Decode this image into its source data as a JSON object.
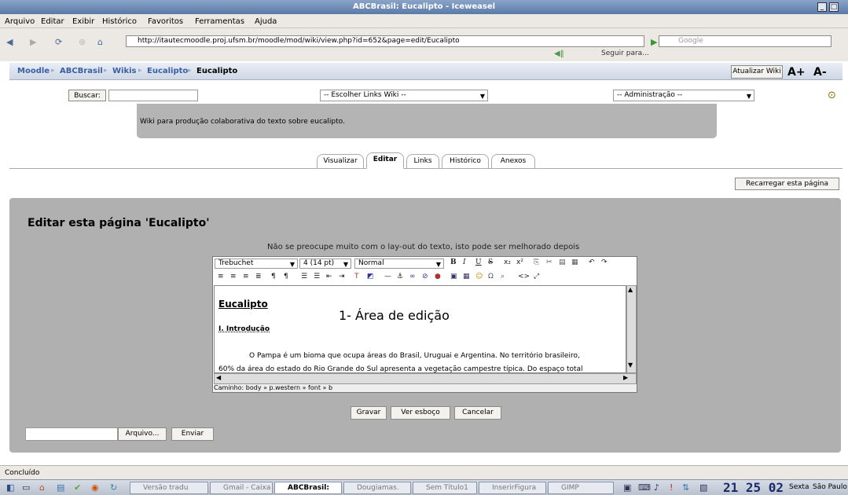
{
  "window": {
    "title": "ABCBrasil: Eucalipto - Iceweasel"
  },
  "menu": [
    "Arquivo",
    "Editar",
    "Exibir",
    "Histórico",
    "Favoritos",
    "Ferramentas",
    "Ajuda"
  ],
  "nav": {
    "url": "http://itautecmoodle.proj.ufsm.br/moodle/mod/wiki/view.php?id=652&page=edit/Eucalipto",
    "search_placeholder": "Google",
    "follow": "Seguir para..."
  },
  "breadcrumb": [
    "Moodle",
    "ABCBrasil",
    "Wikis",
    "Eucalipto",
    "Eucalipto"
  ],
  "header_buttons": {
    "update_wiki": "Atualizar Wiki",
    "font_up": "A+",
    "font_down": "A-"
  },
  "search": {
    "label": "Buscar:",
    "value": ""
  },
  "selects": {
    "wiki_links": "-- Escolher Links Wiki --",
    "admin": "-- Administração --"
  },
  "intro_text": "Wiki para produção colaborativa do texto sobre eucalipto.",
  "tabs": [
    "Visualizar",
    "Editar",
    "Links",
    "Histórico",
    "Anexos"
  ],
  "reload_button": "Recarregar esta página",
  "edit_heading": "Editar esta página 'Eucalipto'",
  "notice": "Não se preocupe muito com o lay-out do texto, isto pode ser melhorado depois",
  "toolbar": {
    "font": "Trebuchet",
    "size": "4 (14 pt)",
    "format": "Normal"
  },
  "editor": {
    "title": "Eucalipto",
    "annotation": "1- Área de edição",
    "section": "I. Introdução",
    "paragraph_line1": "O Pampa é um bioma que ocupa áreas do Brasil, Uruguai e Argentina. No território brasileiro,",
    "paragraph_line2": "60% da área do estado do Rio Grande do Sul apresenta a vegetação campestre típica. Do espaço total",
    "path": "Caminho:  body » p.western » font » b"
  },
  "form_buttons": {
    "save": "Gravar",
    "preview": "Ver esboço",
    "cancel": "Cancelar"
  },
  "upload": {
    "browse": "Arquivo...",
    "send": "Enviar"
  },
  "status": "Concluído",
  "taskbar": {
    "tasks": [
      "Versão tradu",
      "Gmail - Caixa",
      "ABCBrasil:",
      "Dougiamas.",
      "Sem Título1",
      "InserirFigura",
      "GIMP"
    ],
    "clock": "21 25 02",
    "day": "Sexta",
    "city": "São Paulo"
  }
}
